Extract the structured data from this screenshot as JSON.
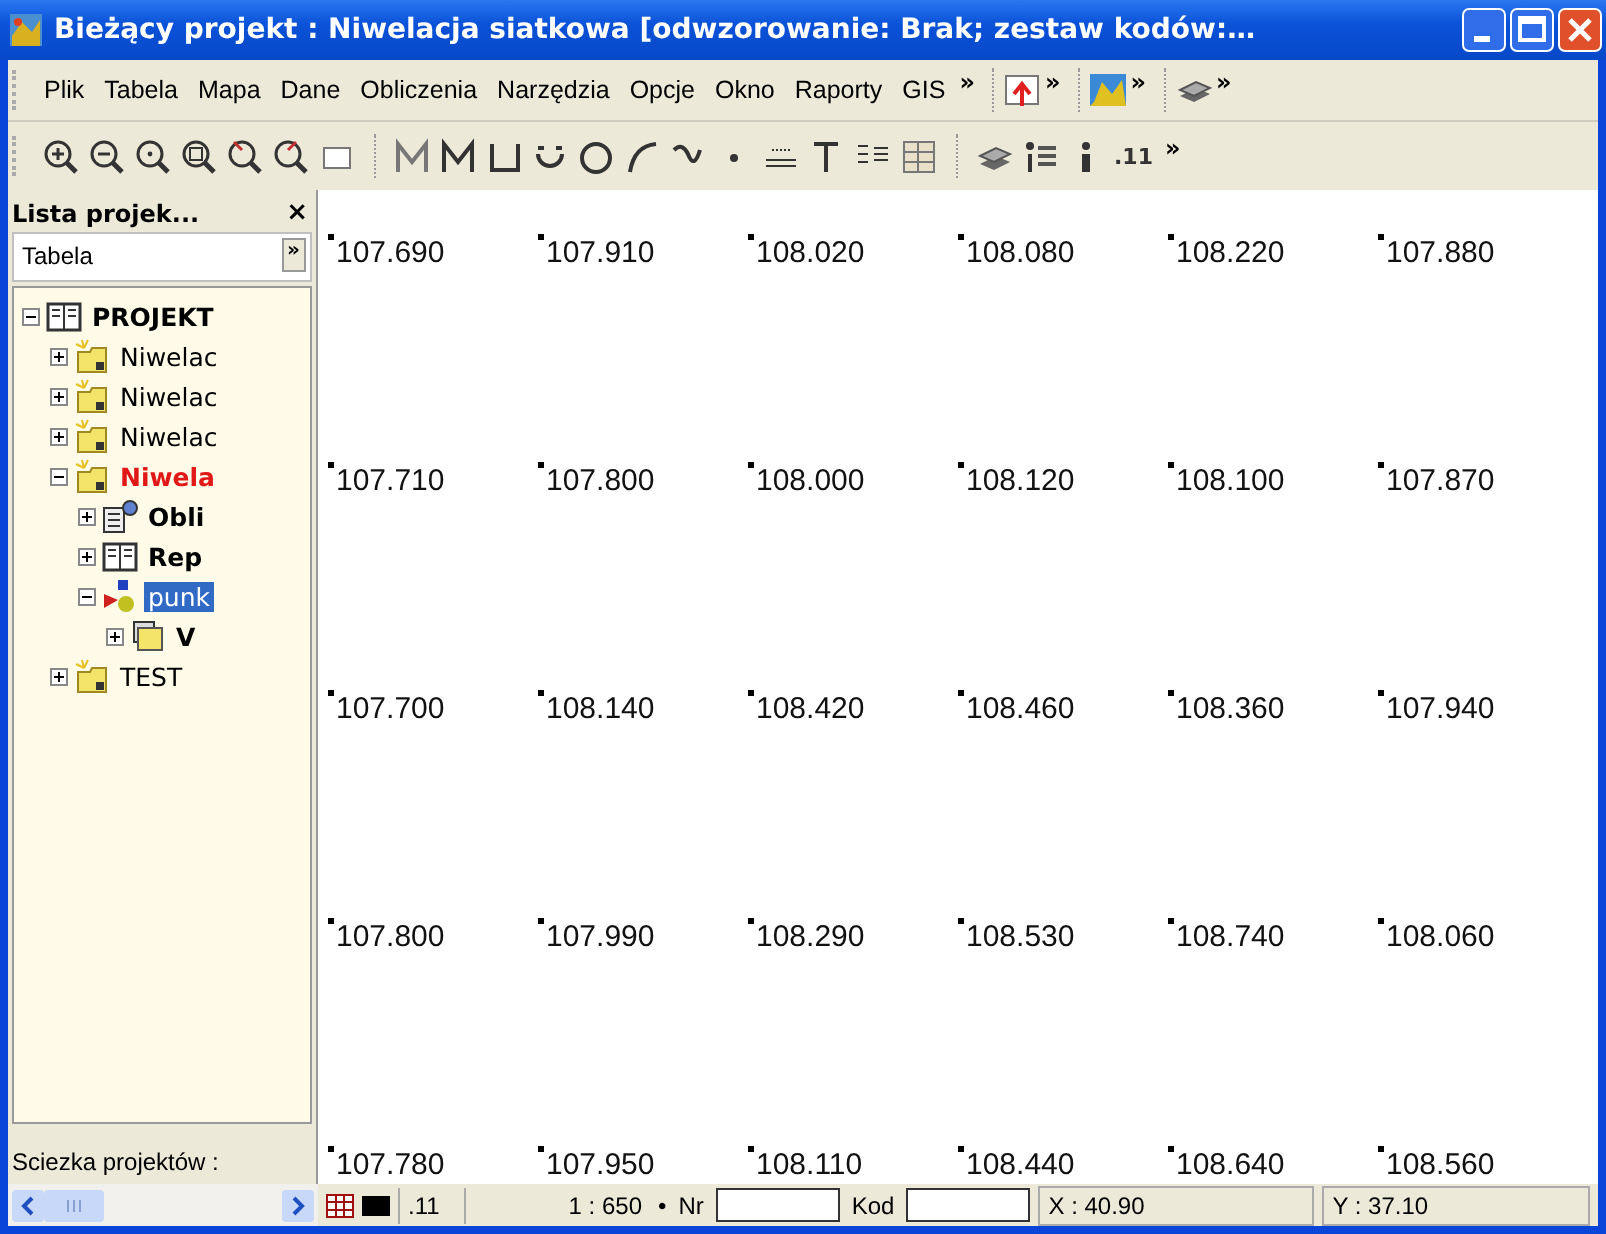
{
  "window": {
    "title": "Bieżący projekt : Niwelacja siatkowa [odwzorowanie: Brak; zestaw kodów:…"
  },
  "menubar": {
    "items": [
      "Plik",
      "Tabela",
      "Mapa",
      "Dane",
      "Obliczenia",
      "Narzędzia",
      "Opcje",
      "Okno",
      "Raporty",
      "GIS"
    ],
    "overflow": "»",
    "extras": [
      {
        "kind": "upload",
        "overflow": "»"
      },
      {
        "kind": "map",
        "overflow": "»"
      },
      {
        "kind": "layers",
        "overflow": "»"
      }
    ]
  },
  "toolbar": {
    "label": ".11",
    "overflow": "»"
  },
  "project_panel": {
    "title": "Lista projek...",
    "close": "×",
    "tab": "Tabela",
    "tab_overflow": "»",
    "path_label": "Sciezka projektów :",
    "tree": [
      {
        "label": "PROJEKT",
        "kind": "book",
        "bold": true,
        "current": false,
        "selected": false,
        "expanded": true,
        "children": [
          {
            "label": "Niwelac",
            "kind": "folder",
            "bold": false,
            "current": false,
            "selected": false,
            "expanded": false
          },
          {
            "label": "Niwelac",
            "kind": "folder",
            "bold": false,
            "current": false,
            "selected": false,
            "expanded": false
          },
          {
            "label": "Niwelac",
            "kind": "folder",
            "bold": false,
            "current": false,
            "selected": false,
            "expanded": false
          },
          {
            "label": "Niwela",
            "kind": "folder",
            "bold": true,
            "current": true,
            "selected": false,
            "expanded": true,
            "children": [
              {
                "label": "Obli",
                "kind": "calc",
                "bold": true,
                "current": false,
                "selected": false,
                "expanded": false
              },
              {
                "label": "Rep",
                "kind": "book",
                "bold": true,
                "current": false,
                "selected": false,
                "expanded": false
              },
              {
                "label": "punk",
                "kind": "network",
                "bold": false,
                "current": false,
                "selected": true,
                "expanded": true,
                "children": [
                  {
                    "label": "V",
                    "kind": "files",
                    "bold": true,
                    "current": false,
                    "selected": false,
                    "expanded": false
                  }
                ]
              }
            ]
          },
          {
            "label": "TEST",
            "kind": "folder",
            "bold": false,
            "current": false,
            "selected": false,
            "expanded": false
          }
        ]
      }
    ]
  },
  "map_points": [
    [
      "107.690",
      "107.910",
      "108.020",
      "108.080",
      "108.220",
      "107.880"
    ],
    [
      "107.710",
      "107.800",
      "108.000",
      "108.120",
      "108.100",
      "107.870"
    ],
    [
      "107.700",
      "108.140",
      "108.420",
      "108.460",
      "108.360",
      "107.940"
    ],
    [
      "107.800",
      "107.990",
      "108.290",
      "108.530",
      "108.740",
      "108.060"
    ],
    [
      "107.780",
      "107.950",
      "108.110",
      "108.440",
      "108.640",
      "108.560"
    ]
  ],
  "status_bar": {
    "label": ".11",
    "scale": "1 : 650",
    "bullet": "•",
    "nr_label": "Nr",
    "kod_label": "Kod",
    "x": "X : 40.90",
    "y": "Y : 37.10"
  }
}
